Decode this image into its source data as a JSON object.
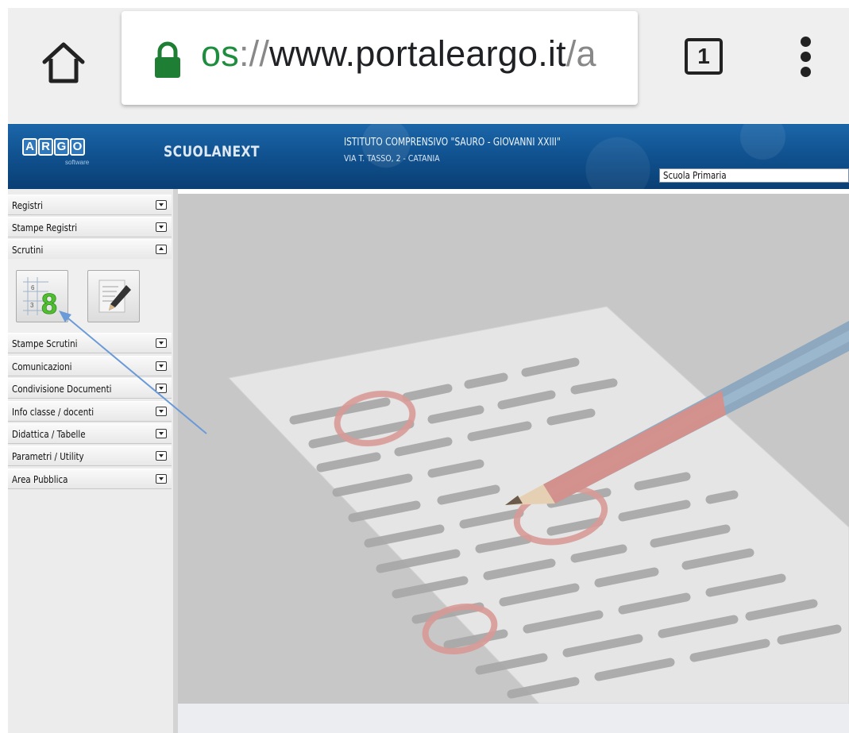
{
  "browser": {
    "url_scheme": "os",
    "url_separator": "://",
    "url_host": "www.portaleargo.it",
    "url_path": "/a",
    "tab_count": "1"
  },
  "header": {
    "logo_letters": [
      "A",
      "R",
      "G",
      "O"
    ],
    "logo_sub": "software",
    "product": "SCUOLANEXT",
    "school_name": "ISTITUTO COMPRENSIVO \"SAURO - GIOVANNI XXIII\"",
    "school_address": "VIA T. TASSO, 2 - CATANIA",
    "school_select": "Scuola Primaria"
  },
  "sidebar": {
    "items": [
      {
        "label": "Registri"
      },
      {
        "label": "Stampe Registri"
      },
      {
        "label": "Scrutini"
      },
      {
        "label": "Stampe Scrutini"
      },
      {
        "label": "Comunicazioni"
      },
      {
        "label": "Condivisione Documenti"
      },
      {
        "label": "Info classe / docenti"
      },
      {
        "label": "Didattica / Tabelle"
      },
      {
        "label": "Parametri / Utility"
      },
      {
        "label": "Area Pubblica"
      }
    ],
    "scrutini_tools": {
      "grades_icon_digit": "8",
      "grid_digits": [
        "6",
        "3"
      ]
    }
  },
  "colors": {
    "header_blue": "#0f4f8c",
    "url_green": "#1e8e3e",
    "annotation_arrow": "#6a9bd8"
  }
}
